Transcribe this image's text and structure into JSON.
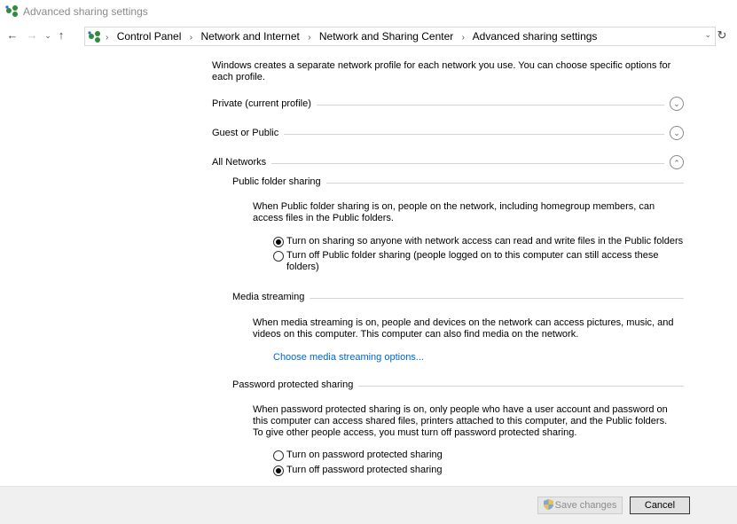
{
  "window": {
    "title": "Advanced sharing settings",
    "app_icon": "network-sharing-icon"
  },
  "nav": {
    "back_icon": "arrow-left-icon",
    "forward_icon": "arrow-right-icon",
    "recent_icon": "chevron-down-icon",
    "up_icon": "arrow-up-icon",
    "refresh_icon": "refresh-icon",
    "breadcrumbs": [
      "Control Panel",
      "Network and Internet",
      "Network and Sharing Center",
      "Advanced sharing settings"
    ]
  },
  "content": {
    "intro": "Windows creates a separate network profile for each network you use. You can choose specific options for each profile.",
    "profiles": [
      {
        "label": "Private (current profile)",
        "expanded": false
      },
      {
        "label": "Guest or Public",
        "expanded": false
      },
      {
        "label": "All Networks",
        "expanded": true
      }
    ],
    "public_folder": {
      "heading": "Public folder sharing",
      "description": "When Public folder sharing is on, people on the network, including homegroup members, can access files in the Public folders.",
      "options": [
        {
          "label": "Turn on sharing so anyone with network access can read and write files in the Public folders",
          "checked": true
        },
        {
          "label": "Turn off Public folder sharing (people logged on to this computer can still access these folders)",
          "checked": false
        }
      ]
    },
    "media": {
      "heading": "Media streaming",
      "description": "When media streaming is on, people and devices on the network can access pictures, music, and videos on this computer. This computer can also find media on the network.",
      "link": "Choose media streaming options..."
    },
    "password": {
      "heading": "Password protected sharing",
      "description": "When password protected sharing is on, only people who have a user account and password on this computer can access shared files, printers attached to this computer, and the Public folders. To give other people access, you must turn off password protected sharing.",
      "options": [
        {
          "label": "Turn on password protected sharing",
          "checked": false
        },
        {
          "label": "Turn off password protected sharing",
          "checked": true
        }
      ]
    }
  },
  "footer": {
    "save_label": "Save changes",
    "cancel_label": "Cancel"
  },
  "colors": {
    "link": "#0066cc",
    "footer_bg": "#f0f0f0",
    "disabled_text": "#8d8d8d"
  }
}
